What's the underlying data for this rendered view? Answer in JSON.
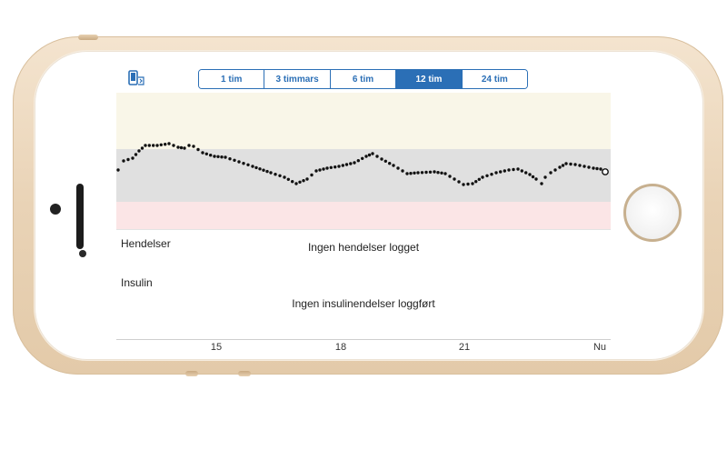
{
  "toolbar": {
    "phone_icon": "phone-sync-icon",
    "ranges": [
      {
        "label": "1 tim",
        "active": false
      },
      {
        "label": "3 timmars",
        "active": false
      },
      {
        "label": "6 tim",
        "active": false
      },
      {
        "label": "12 tim",
        "active": true
      },
      {
        "label": "24 tim",
        "active": false
      }
    ]
  },
  "events": {
    "title": "Hendelser",
    "empty_message": "Ingen hendelser logget"
  },
  "insulin": {
    "title": "Insulin",
    "empty_message": "Ingen insulinendelser loggført"
  },
  "xaxis": {
    "ticks": [
      "15",
      "18",
      "21",
      "Nu"
    ]
  },
  "colors": {
    "accent": "#2b6fb6",
    "high_zone": "#f9f6e8",
    "target_zone": "#e0e0e0",
    "low_zone": "#fbe5e6",
    "trace": "#111111",
    "phone_gold": "#e9d3b6"
  }
}
